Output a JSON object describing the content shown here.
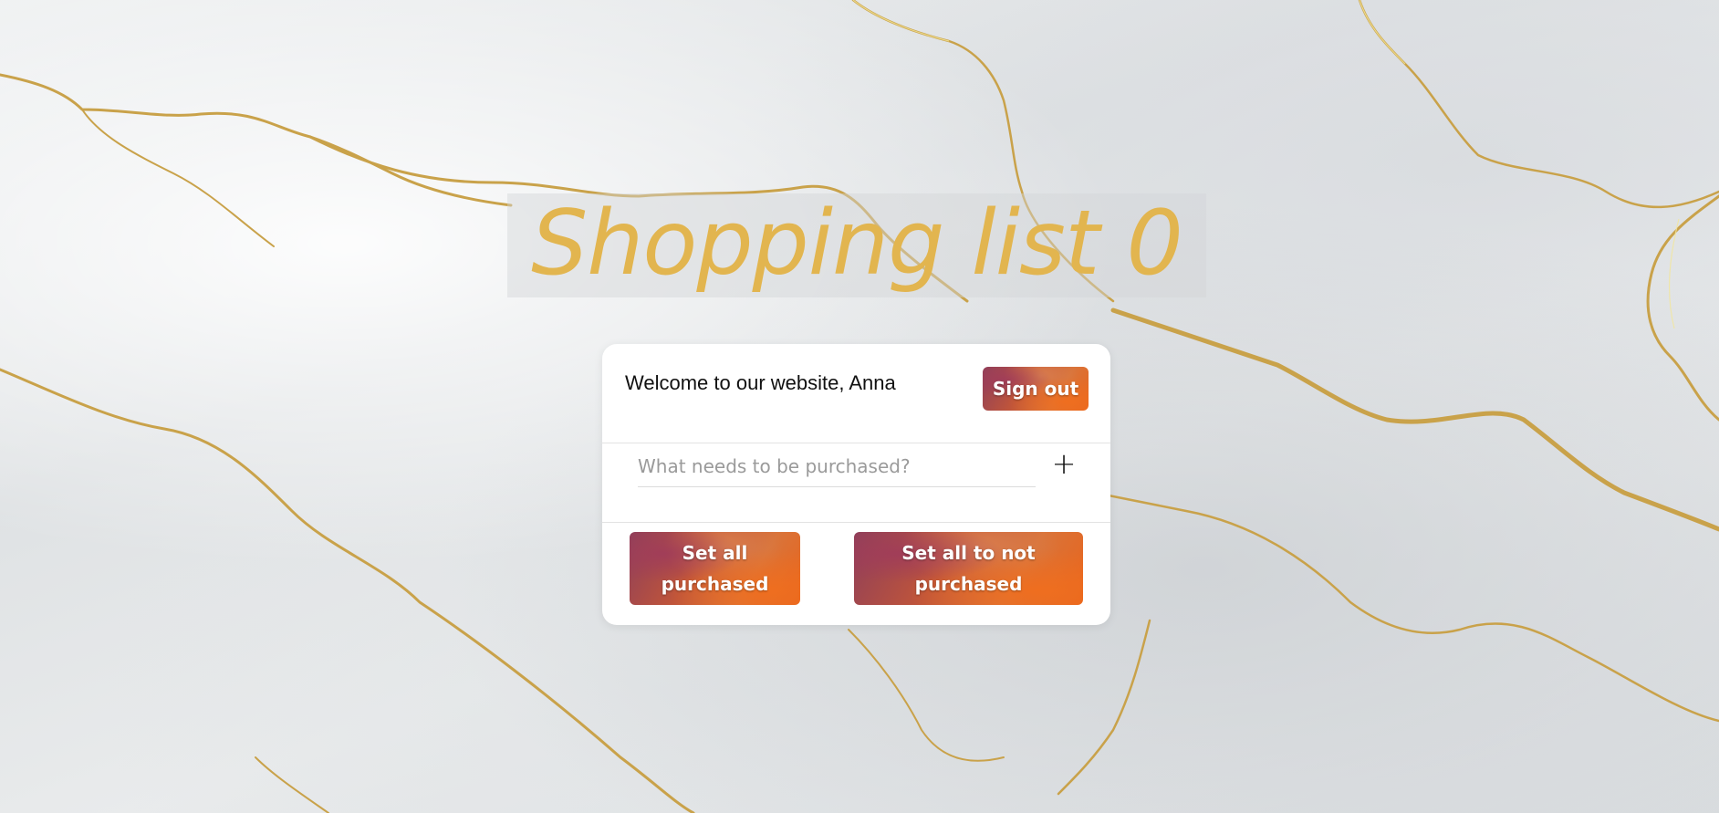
{
  "page": {
    "title": "Shopping list 0",
    "title_color": "#e2b54f",
    "background_icon": "marble-background"
  },
  "card": {
    "welcome_text": "Welcome to our website, Anna",
    "sign_out_label": "Sign out",
    "new_item": {
      "placeholder": "What needs to be purchased?",
      "value": ""
    },
    "add_button_label": "+",
    "set_all_purchased_label": "Set all purchased",
    "set_all_not_purchased_label": "Set all to not purchased",
    "button_accent": "#d9743a"
  }
}
